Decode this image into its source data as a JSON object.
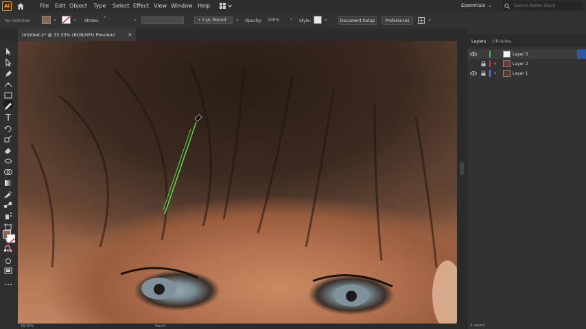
{
  "app": {
    "logo": "Ai"
  },
  "menubar": {
    "items": [
      "File",
      "Edit",
      "Object",
      "Type",
      "Select",
      "Effect",
      "View",
      "Window",
      "Help"
    ],
    "workspace": "Essentials",
    "search_placeholder": "Search Adobe Stock"
  },
  "control": {
    "selection": "No Selection",
    "stroke_label": "Stroke:",
    "brush": "5 pt. Round",
    "opacity_label": "Opacity:",
    "opacity_value": "100%",
    "style_label": "Style:",
    "document_setup": "Document Setup",
    "preferences": "Preferences",
    "fill_color": "#8a6550",
    "stroke_color": "#d83030"
  },
  "document": {
    "tab_title": "Untitled-2* @ 33.33% (RGB/GPU Preview)",
    "zoom": "33.33%",
    "status_mid": "Pencil"
  },
  "panel": {
    "tabs": [
      "Layers",
      "Libraries"
    ],
    "layers": [
      {
        "name": "Layer 3",
        "color": "#3ec43e",
        "selected": true
      },
      {
        "name": "Layer 2",
        "color": "#e03030",
        "selected": false
      },
      {
        "name": "Layer 1",
        "color": "#4a7cff",
        "selected": false
      }
    ],
    "footer": "3 Layers"
  },
  "icons": [
    "home-icon",
    "workspace-switcher-icon",
    "search-icon",
    "selection-tool-icon",
    "direct-selection-tool-icon",
    "pen-tool-icon",
    "curvature-tool-icon",
    "rectangle-tool-icon",
    "pencil-tool-icon",
    "type-tool-icon",
    "rotate-tool-icon",
    "scale-tool-icon",
    "eraser-tool-icon",
    "width-tool-icon",
    "shape-builder-icon",
    "gradient-tool-icon",
    "eyedropper-tool-icon",
    "blend-tool-icon",
    "symbol-sprayer-icon",
    "artboard-tool-icon",
    "hand-tool-icon",
    "zoom-tool-icon",
    "eye-icon",
    "lock-icon",
    "chevron-right-icon",
    "close-icon"
  ]
}
